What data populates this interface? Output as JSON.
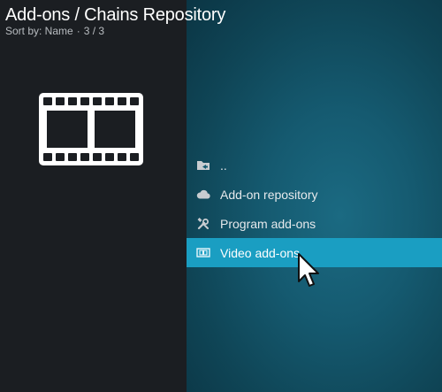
{
  "header": {
    "title": "Add-ons  / Chains Repository",
    "sort_label": "Sort by: Name",
    "separator": "·",
    "count": "3 / 3"
  },
  "left_panel": {
    "icon": "film-strip-icon"
  },
  "menu": {
    "items": [
      {
        "label": "..",
        "icon": "back-folder-icon"
      },
      {
        "label": "Add-on repository",
        "icon": "cloud-icon"
      },
      {
        "label": "Program add-ons",
        "icon": "tools-icon"
      },
      {
        "label": "Video add-ons",
        "icon": "video-icon",
        "selected": true
      }
    ]
  },
  "colors": {
    "left_bg": "#1b1e22",
    "right_bg": "#155a70",
    "selection": "#1a9ec2",
    "text": "#e6e9ec"
  },
  "cursor": {
    "icon": "mouse-pointer-icon"
  }
}
